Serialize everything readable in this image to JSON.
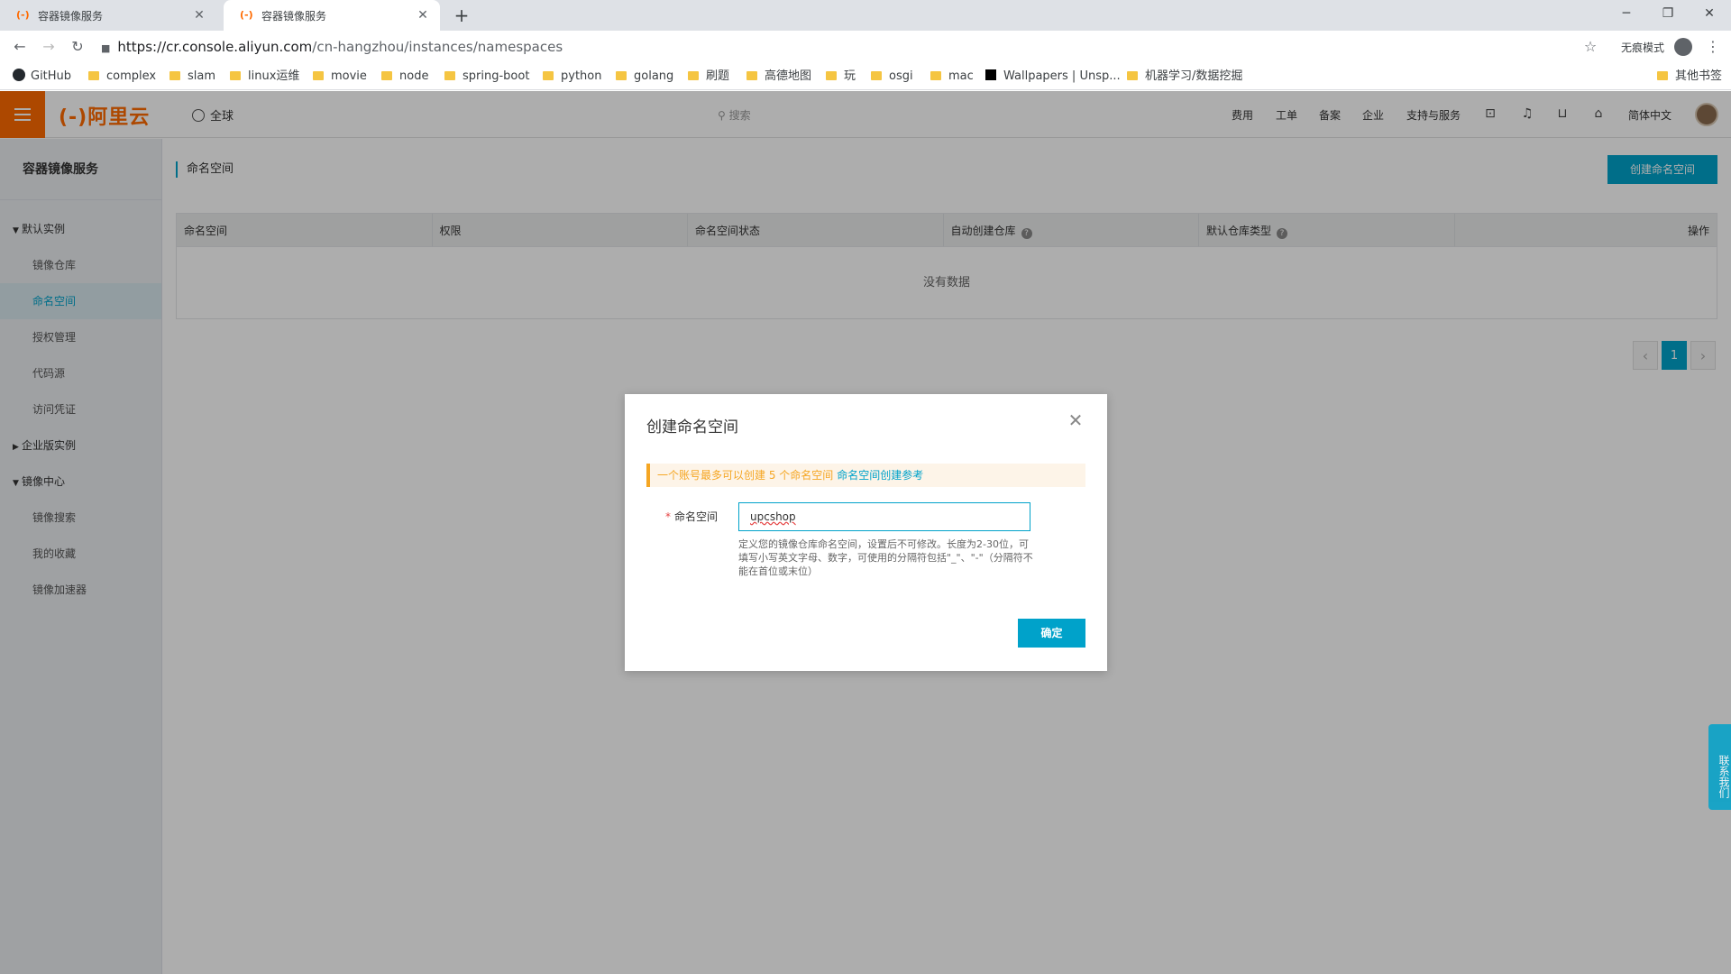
{
  "browser": {
    "tabs": [
      {
        "title": "容器镜像服务",
        "favicon": "aliyun-icon"
      },
      {
        "title": "容器镜像服务",
        "favicon": "aliyun-icon"
      }
    ],
    "url_host": "https://cr.console.aliyun.com",
    "url_path": "/cn-hangzhou/instances/namespaces",
    "incognito_label": "无痕模式",
    "bookmarks": [
      "GitHub",
      "complex",
      "slam",
      "linux运维",
      "movie",
      "node",
      "spring-boot",
      "python",
      "golang",
      "刷题",
      "高德地图",
      "玩",
      "osgi",
      "mac",
      "Wallpapers | Unsp...",
      "机器学习/数据挖掘",
      "其他书签"
    ]
  },
  "topnav": {
    "logo": "(-)阿里云",
    "region": "全球",
    "search_placeholder": "搜索",
    "items": [
      "费用",
      "工单",
      "备案",
      "企业",
      "支持与服务"
    ],
    "language": "简体中文"
  },
  "sidebar": {
    "title": "容器镜像服务",
    "groups": [
      {
        "label": "默认实例",
        "expanded": true,
        "items": [
          "镜像仓库",
          "命名空间",
          "授权管理",
          "代码源",
          "访问凭证"
        ]
      },
      {
        "label": "企业版实例",
        "expanded": false,
        "items": []
      },
      {
        "label": "镜像中心",
        "expanded": true,
        "items": [
          "镜像搜索",
          "我的收藏",
          "镜像加速器"
        ]
      }
    ],
    "active_item": "命名空间"
  },
  "main": {
    "breadcrumb": "命名空间",
    "create_button": "创建命名空间",
    "table": {
      "columns": [
        "命名空间",
        "权限",
        "命名空间状态",
        "自动创建仓库",
        "默认仓库类型",
        "操作"
      ],
      "empty_text": "没有数据"
    },
    "pagination": {
      "current": "1"
    }
  },
  "contact": "联系我们",
  "modal": {
    "title": "创建命名空间",
    "notice": "一个账号最多可以创建 5 个命名空间",
    "notice_link": "命名空间创建参考",
    "field_label": "命名空间",
    "field_value": "upcshop",
    "field_help": "定义您的镜像仓库命名空间，设置后不可修改。长度为2-30位，可填写小写英文字母、数字，可使用的分隔符包括\"_\"、\"-\"（分隔符不能在首位或末位）",
    "ok_button": "确定"
  }
}
